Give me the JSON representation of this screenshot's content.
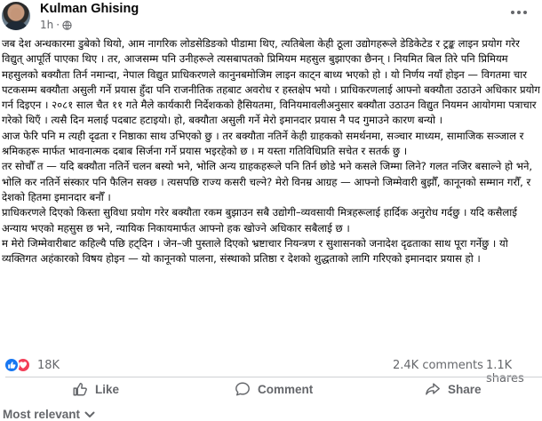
{
  "post": {
    "author": "Kulman Ghising",
    "time": "1h",
    "dot": "·",
    "paragraphs": [
      "जब देश अन्धकारमा डुबेको थियो, आम नागरिक लोडसेडिङको पीडामा थिए, त्यतिबेला केही ठूला उद्योगहरूले डेडिकेटेड र ट्रङ्क लाइन प्रयोग गरेर विद्युत् आपूर्ति पाएका थिए । तर, आजसम्म पनि उनीहरूले त्यसबापतको प्रिमियम महसुल बुझाएका छैनन् । नियमित बिल तिरे पनि प्रिमियम महसुलको बक्यौता तिर्न नमान्दा, नेपाल विद्युत प्राधिकरणले कानुनबमोजिम लाइन काट्न बाध्य भएको हो । यो निर्णय नयाँ होइन — विगतमा चार पटकसम्म बक्यौता असुली गर्ने प्रयास हुँदा पनि राजनीतिक तहबाट अवरोध र हस्तक्षेप भयो । प्राधिकरणलाई आफ्नो बक्यौता उठाउने अधिकार प्रयोग गर्न दिइएन । २०८१ साल चैत ११ गते मैले कार्यकारी निर्देशकको हैसियतमा, विनियमावलीअनुसार बक्यौता उठाउन विद्युत नियमन आयोगमा पत्राचार गरेको थिएँ । त्यसै दिन मलाई पदबाट हटाइयो। हो, बक्यौता असुली गर्ने मेरो इमानदार प्रयास नै पद गुमाउने कारण बन्यो ।",
      "आज फेरि पनि म त्यही दृढता र निष्ठाका साथ उभिएको छु । तर बक्यौता नतिर्ने केही ग्राहकको समर्थनमा, सञ्चार माध्यम, सामाजिक सञ्जाल र श्रमिकहरू मार्फत भावनात्मक दबाब सिर्जना गर्ने प्रयास भइरहेको छ । म यस्ता गतिविधिप्रति सचेत र सतर्क छु ।",
      "तर सोचौँ त — यदि बक्यौता नतिर्ने चलन बस्यो भने, भोलि अन्य ग्राहकहरूले पनि तिर्न छोडे भने कसले जिम्मा लिने? गलत नजिर बसाल्ने हो भने, भोलि कर नतिर्ने संस्कार पनि फैलिन सक्छ । त्यसपछि राज्य कसरी चल्ने? मेरो विनम्र आग्रह — आफ्नो जिम्मेवारी बुझौँ, कानूनको सम्मान गरौँ, र देशको हितमा इमानदार बनौँ ।",
      "प्राधिकरणले दिएको किस्ता सुविधा प्रयोग गरेर बक्यौता रकम बुझाउन सबै उद्योगी–व्यवसायी मित्रहरूलाई हार्दिक अनुरोध गर्दछु । यदि कसैलाई अन्याय भएको महसुस छ भने, न्यायिक निकायमार्फत आफ्नो हक खोज्ने अधिकार सबैलाई छ ।",
      "म मेरो जिम्मेवारीबाट कहिल्यै पछि हट्दिन । जेन–जी पुस्ताले दिएको भ्रष्टाचार नियन्त्रण र सुशासनको जनादेश दृढताका साथ पूरा गर्नेछु । यो व्यक्तिगत अहंकारको विषय होइन — यो कानूनको पालना, संस्थाको प्रतिष्ठा र देशको शुद्धताको लागि गरिएको इमानदार प्रयास हो ।"
    ]
  },
  "stats": {
    "reaction_count": "18K",
    "comments": "2.4K comments",
    "shares": "1.1K shares"
  },
  "actions": {
    "like": "Like",
    "comment": "Comment",
    "share": "Share"
  },
  "comments_filter": {
    "label": "Most relevant",
    "icon": "chevron-down-icon"
  },
  "colors": {
    "like_blue": "#1877f2",
    "love_red": "#f33e58",
    "secondary_text": "#65676b",
    "primary_text": "#050505"
  }
}
